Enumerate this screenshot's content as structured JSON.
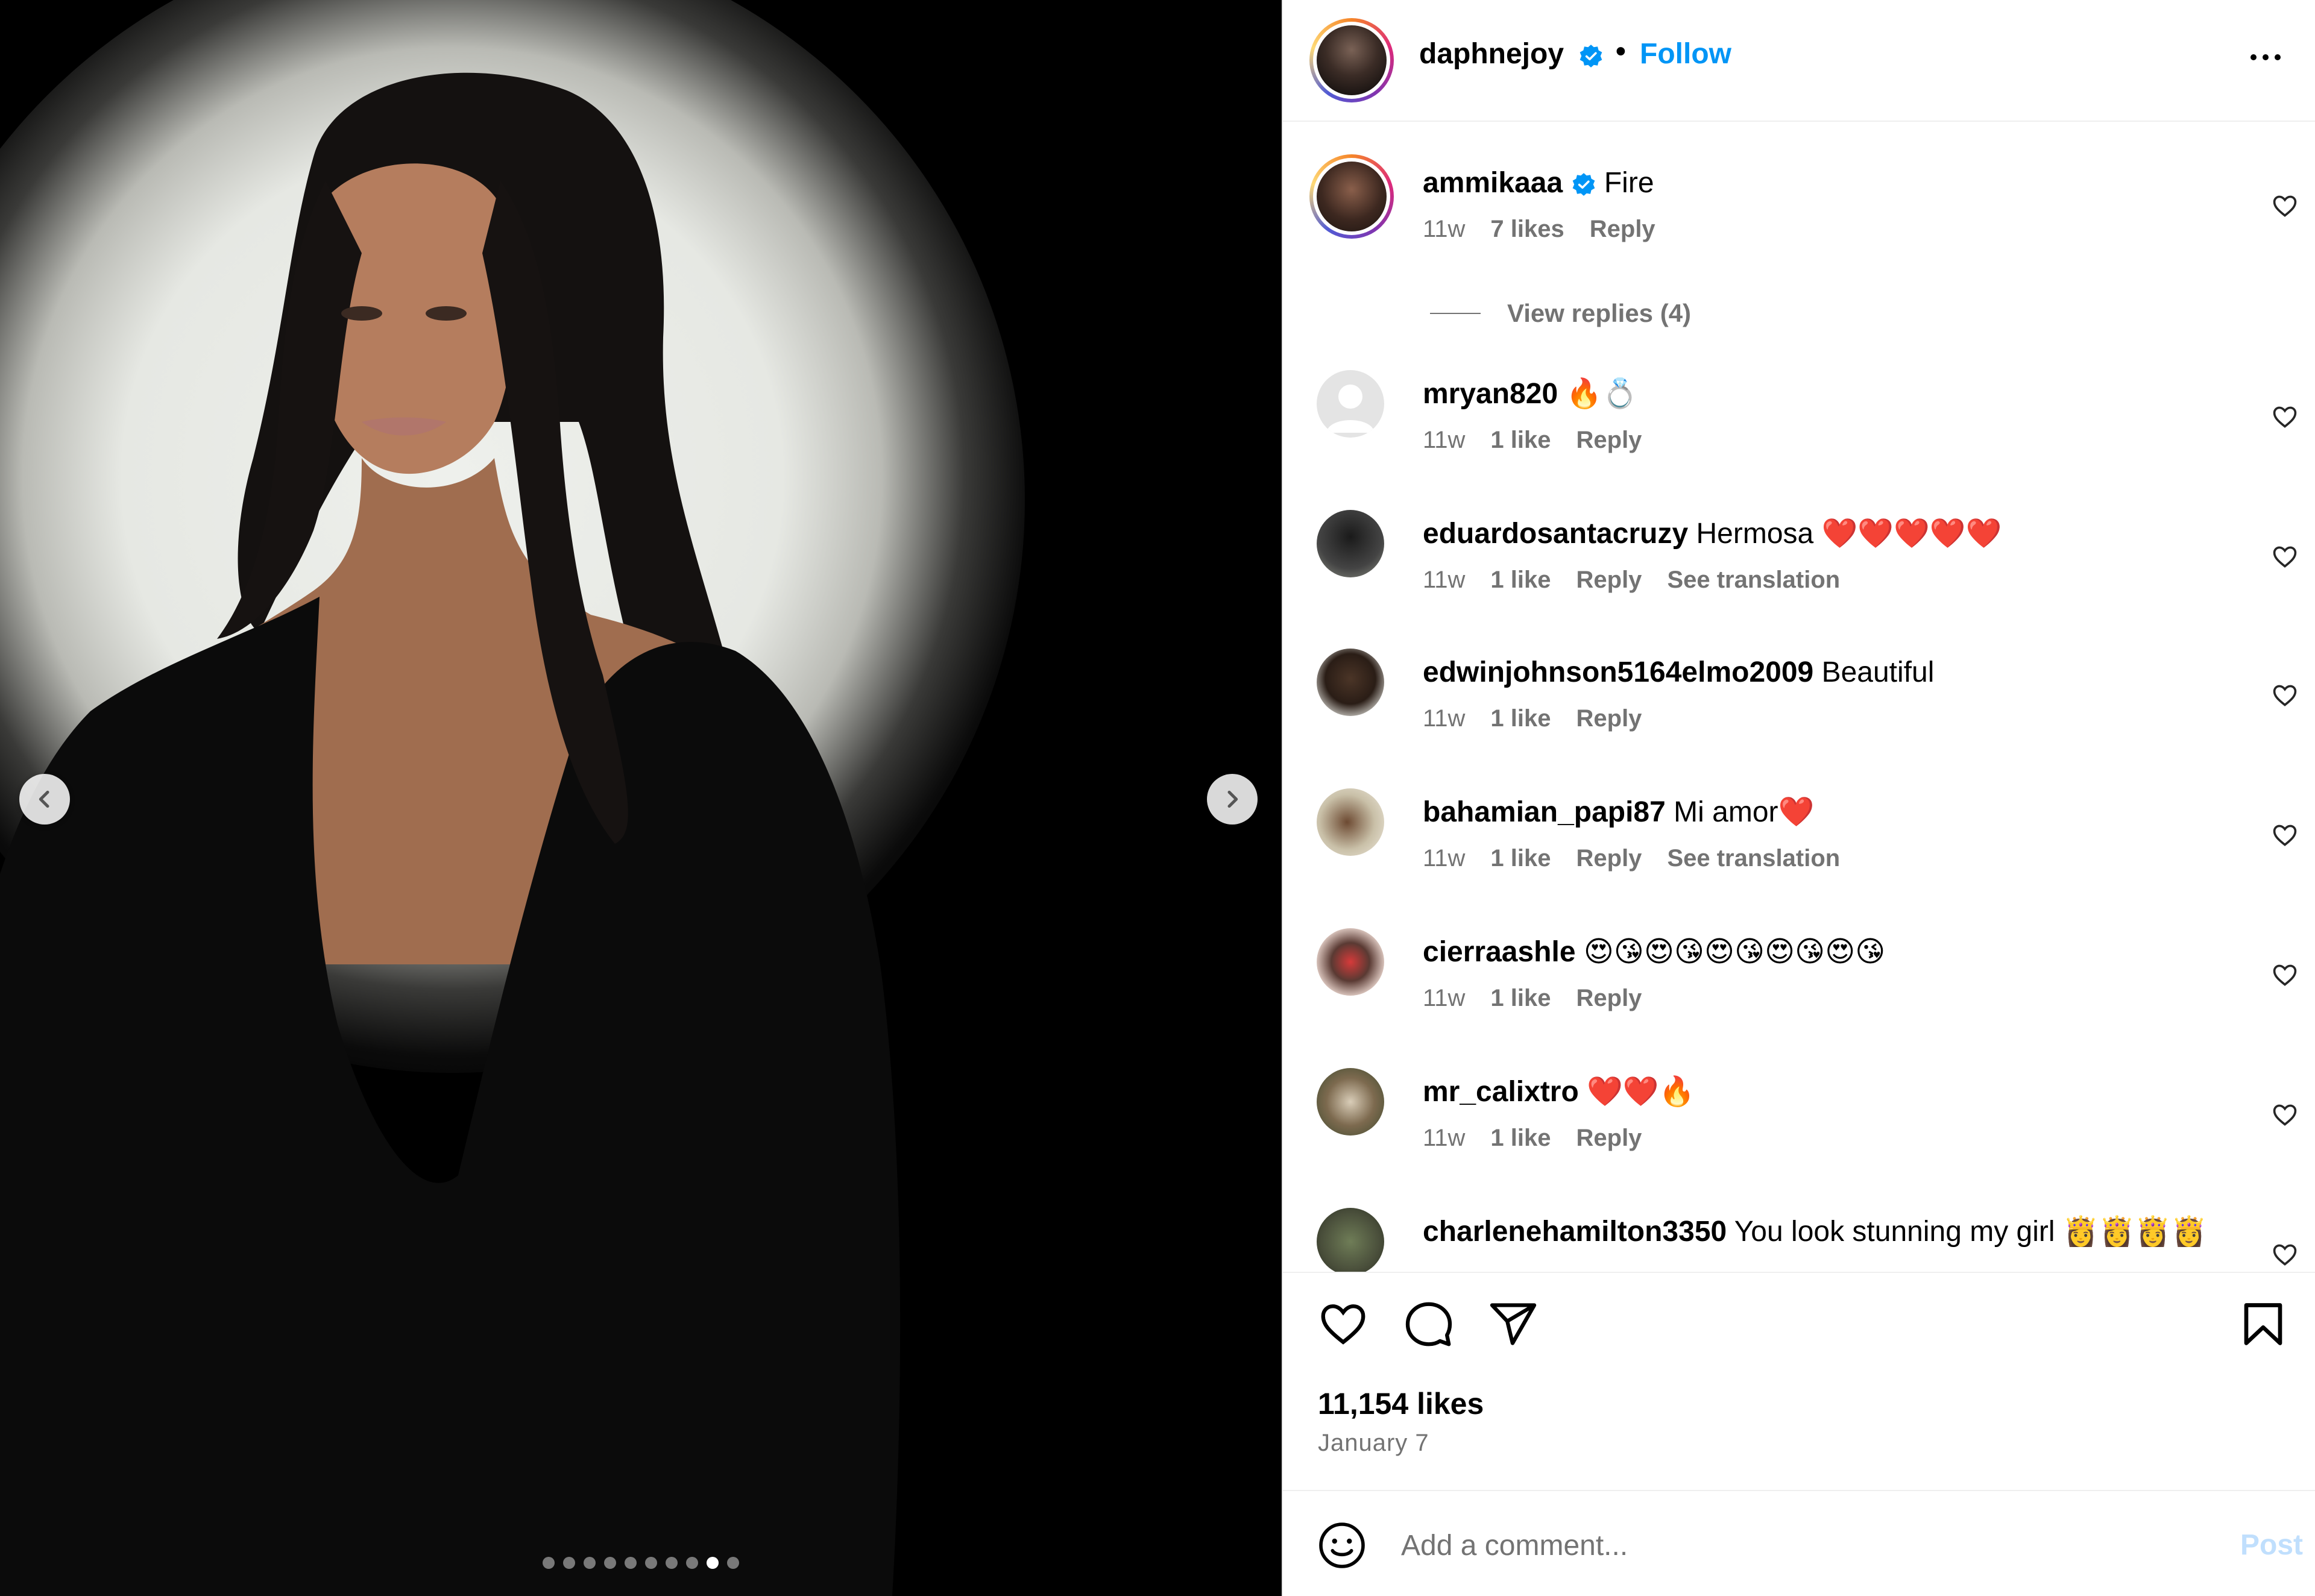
{
  "media": {
    "carousel_total": 10,
    "carousel_active_index": 8,
    "prev_icon": "chevron-left-icon",
    "next_icon": "chevron-right-icon"
  },
  "header": {
    "username": "daphnejoy",
    "separator": "•",
    "follow_label": "Follow",
    "verified_icon": "verified-badge-icon",
    "more_icon": "more-options-icon"
  },
  "comments": [
    {
      "user": "ammikaaa",
      "verified": true,
      "text": "Fire",
      "time": "11w",
      "likes": "7 likes",
      "reply": "Reply",
      "translate": "",
      "story_ring": true
    },
    {
      "user": "mryan820",
      "text": "🔥💍",
      "time": "11w",
      "likes": "1 like",
      "reply": "Reply",
      "translate": ""
    },
    {
      "user": "eduardosantacruzy",
      "text": "Hermosa ❤️❤️❤️❤️❤️",
      "time": "11w",
      "likes": "1 like",
      "reply": "Reply",
      "translate": "See translation"
    },
    {
      "user": "edwinjohnson5164elmo2009",
      "text": "Beautiful",
      "time": "11w",
      "likes": "1 like",
      "reply": "Reply",
      "translate": ""
    },
    {
      "user": "bahamian_papi87",
      "text": "Mi amor❤️",
      "time": "11w",
      "likes": "1 like",
      "reply": "Reply",
      "translate": "See translation"
    },
    {
      "user": "cierraashle",
      "text": "😍😘😍😘😍😘😍😘😍😘",
      "time": "11w",
      "likes": "1 like",
      "reply": "Reply",
      "translate": ""
    },
    {
      "user": "mr_calixtro",
      "text": "❤️❤️🔥",
      "time": "11w",
      "likes": "1 like",
      "reply": "Reply",
      "translate": ""
    },
    {
      "user": "charlenehamilton3350",
      "text": "You look stunning my girl 👸👸👸👸",
      "time": "",
      "likes": "",
      "reply": "",
      "translate": ""
    }
  ],
  "view_replies": "View replies (4)",
  "actions": {
    "like_icon": "heart-icon",
    "comment_icon": "comment-icon",
    "share_icon": "send-icon",
    "save_icon": "bookmark-icon"
  },
  "likes_count": "11,154 likes",
  "post_date": "January 7",
  "add_comment": {
    "placeholder": "Add a comment...",
    "post_label": "Post",
    "emoji_icon": "emoji-icon"
  },
  "colors": {
    "link_blue": "#0095f6",
    "muted_text": "#737373",
    "post_disabled": "#c0dffd"
  }
}
